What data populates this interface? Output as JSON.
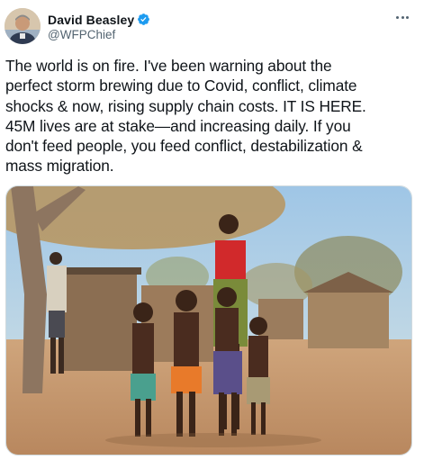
{
  "author": {
    "display_name": "David Beasley",
    "handle": "@WFPChief",
    "verified": true,
    "avatar_icon": "avatar-photo"
  },
  "tweet": {
    "text": "The world is on fire. I've been warning about the\nperfect storm brewing due to Covid, conflict, climate\nshocks & now, rising supply chain costs. IT IS HERE.\n45M lives are at stake—and increasing daily. If you\ndon't feed people, you feed conflict, destabilization &\nmass migration."
  },
  "icons": {
    "verified": "verified-badge-icon",
    "more": "more-options-icon"
  },
  "colors": {
    "verified_blue": "#1d9bf0",
    "text_primary": "#0f1419",
    "text_secondary": "#536471",
    "border": "#cfd9de"
  }
}
